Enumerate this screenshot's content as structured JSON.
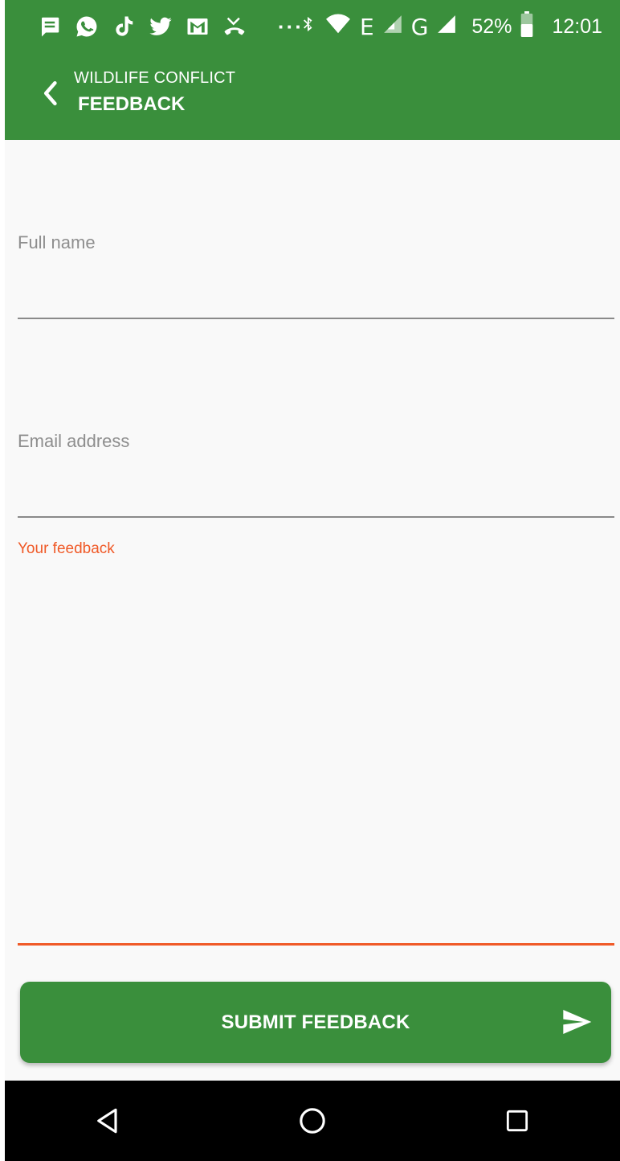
{
  "status_bar": {
    "battery": "52%",
    "time": "12:01",
    "network_label_1": "E",
    "network_label_2": "G",
    "more_dots": "···",
    "notification_icons": [
      "message-icon",
      "whatsapp-icon",
      "tiktok-icon",
      "twitter-icon",
      "gmail-icon",
      "missed-call-icon"
    ]
  },
  "app_bar": {
    "supertitle": "WILDLIFE CONFLICT",
    "title": "FEEDBACK"
  },
  "form": {
    "full_name": {
      "placeholder": "Full name",
      "value": ""
    },
    "email": {
      "placeholder": "Email address",
      "value": ""
    },
    "feedback": {
      "label": "Your feedback",
      "value": ""
    }
  },
  "submit": {
    "label": "SUBMIT FEEDBACK"
  },
  "colors": {
    "primary": "#3a8f3c",
    "accent": "#f05a28",
    "background": "#f9f9f9"
  }
}
